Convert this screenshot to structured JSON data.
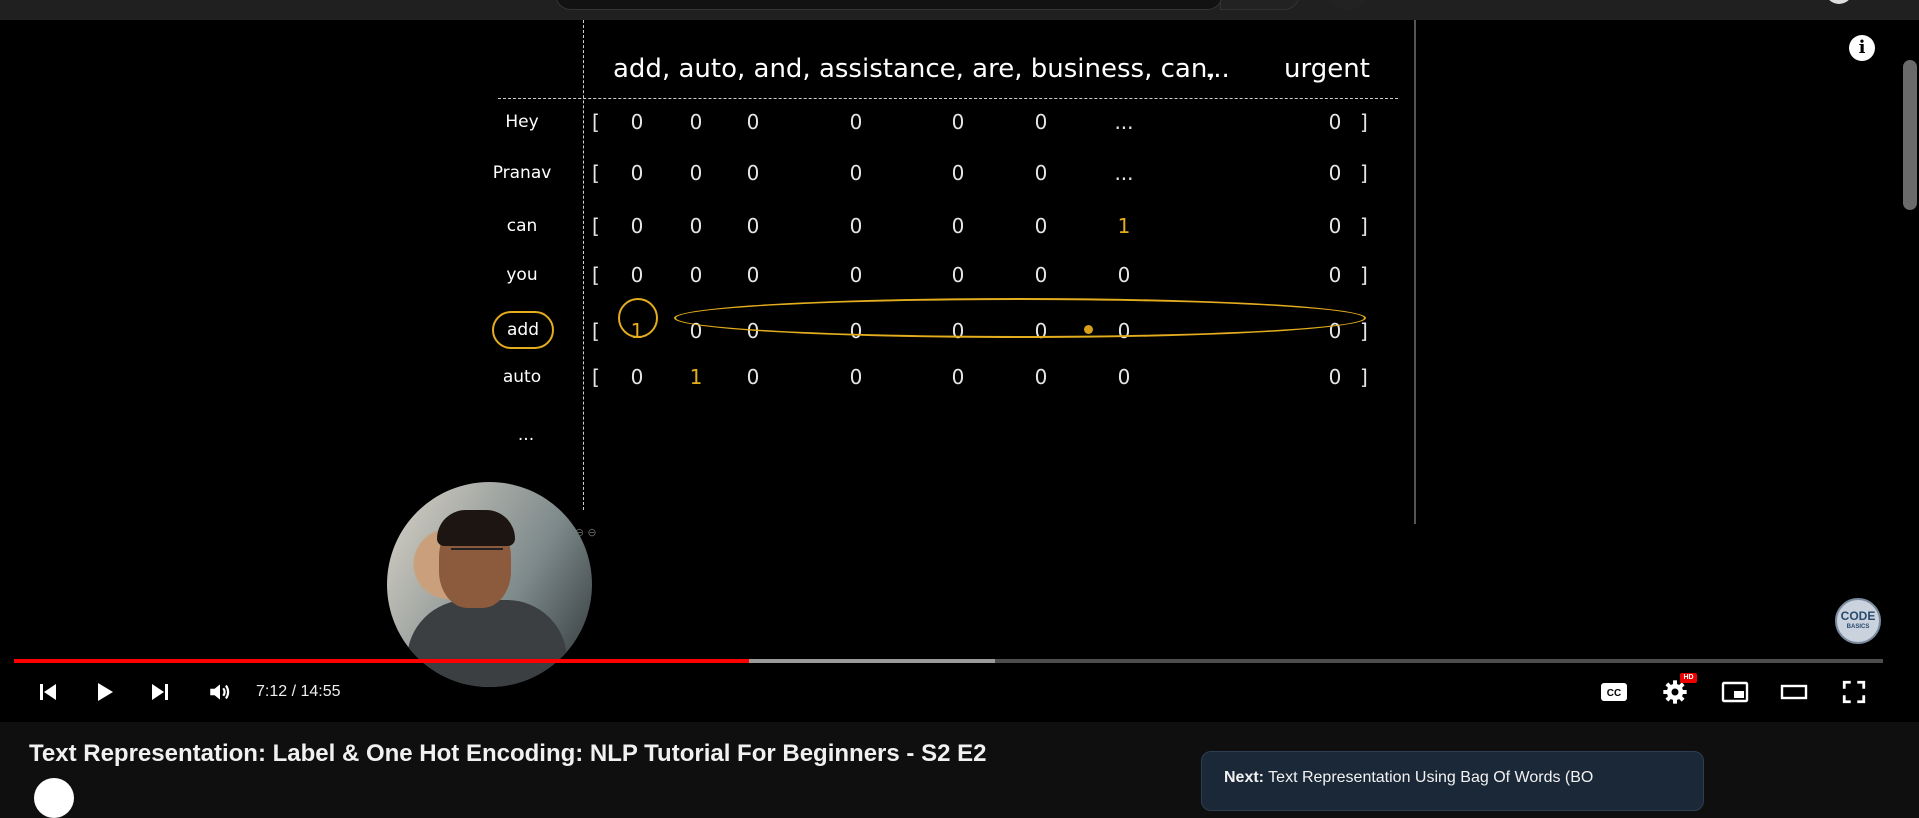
{
  "video": {
    "title": "Text Representation: Label & One Hot Encoding: NLP Tutorial For Beginners - S2 E2",
    "current_time": "7:12",
    "duration": "14:55",
    "time_display": "7:12 / 14:55",
    "played_fraction": 0.393,
    "buffered_fraction": 0.525,
    "hd_badge": "HD",
    "info_icon": "i"
  },
  "slide": {
    "vocab_header": "add, auto, and, assistance, are, business, can,",
    "vocab_ellipsis": "...",
    "vocab_last": "urgent",
    "rows": [
      {
        "word": "Hey",
        "values": [
          "0",
          "0",
          "0",
          "0",
          "0",
          "0",
          "...",
          "0"
        ]
      },
      {
        "word": "Pranav",
        "values": [
          "0",
          "0",
          "0",
          "0",
          "0",
          "0",
          "...",
          "0"
        ]
      },
      {
        "word": "can",
        "values": [
          "0",
          "0",
          "0",
          "0",
          "0",
          "0",
          "1",
          "0"
        ]
      },
      {
        "word": "you",
        "values": [
          "0",
          "0",
          "0",
          "0",
          "0",
          "0",
          "0",
          "0"
        ]
      },
      {
        "word": "add",
        "values": [
          "1",
          "0",
          "0",
          "0",
          "0",
          "0",
          "0",
          "0"
        ]
      },
      {
        "word": "auto",
        "values": [
          "0",
          "1",
          "0",
          "0",
          "0",
          "0",
          "0",
          "0"
        ]
      }
    ],
    "more_rows": "...",
    "open_bracket": "[",
    "close_bracket": "]",
    "mini_label": "⊕ ⊖ ⊖",
    "channel_logo_line1": "CODE",
    "channel_logo_line2": "BASICS"
  },
  "up_next": {
    "prefix": "Next:",
    "title": "Text Representation Using Bag Of Words (BO"
  },
  "icons": [
    "previous-icon",
    "play-icon",
    "next-icon",
    "volume-icon",
    "captions-icon",
    "settings-icon",
    "miniplayer-icon",
    "theater-icon",
    "fullscreen-icon",
    "info-icon"
  ],
  "colors": {
    "accent_yellow": "#e3ad1e",
    "progress_red": "#ff0000"
  }
}
